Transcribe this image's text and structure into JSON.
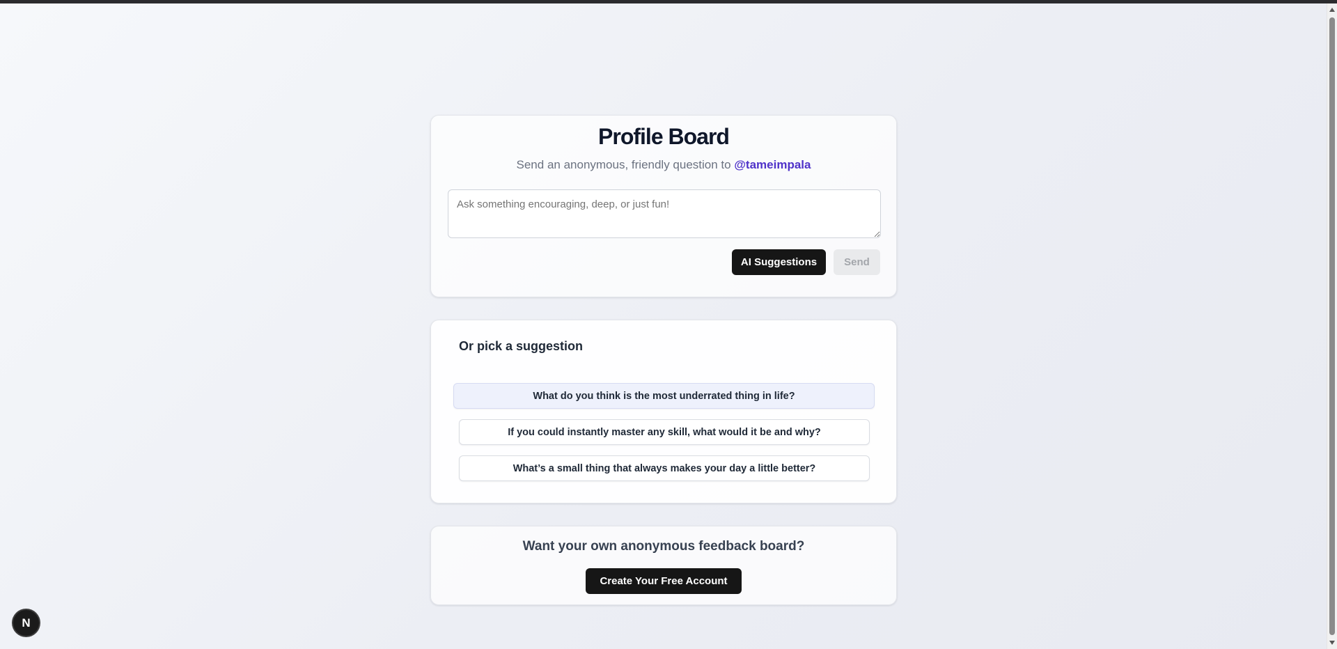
{
  "header": {
    "title": "Profile Board",
    "subtitle_prefix": "Send an anonymous, friendly question to",
    "handle": "@tameimpala"
  },
  "composer": {
    "placeholder": "Ask something encouraging, deep, or just fun!",
    "value": "",
    "ai_button_label": "AI Suggestions",
    "send_button_label": "Send"
  },
  "suggestions": {
    "heading": "Or pick a suggestion",
    "items": [
      "What do you think is the most underrated thing in life?",
      "If you could instantly master any skill, what would it be and why?",
      "What’s a small thing that always makes your day a little better?"
    ]
  },
  "cta": {
    "heading": "Want your own anonymous feedback board?",
    "button_label": "Create Your Free Account"
  },
  "dev_badge": {
    "letter": "N",
    "icon": "nextjs-icon"
  },
  "colors": {
    "handle": "#4f32c9",
    "primary_button": "#161616",
    "highlight_suggestion": "#eef1fc"
  }
}
